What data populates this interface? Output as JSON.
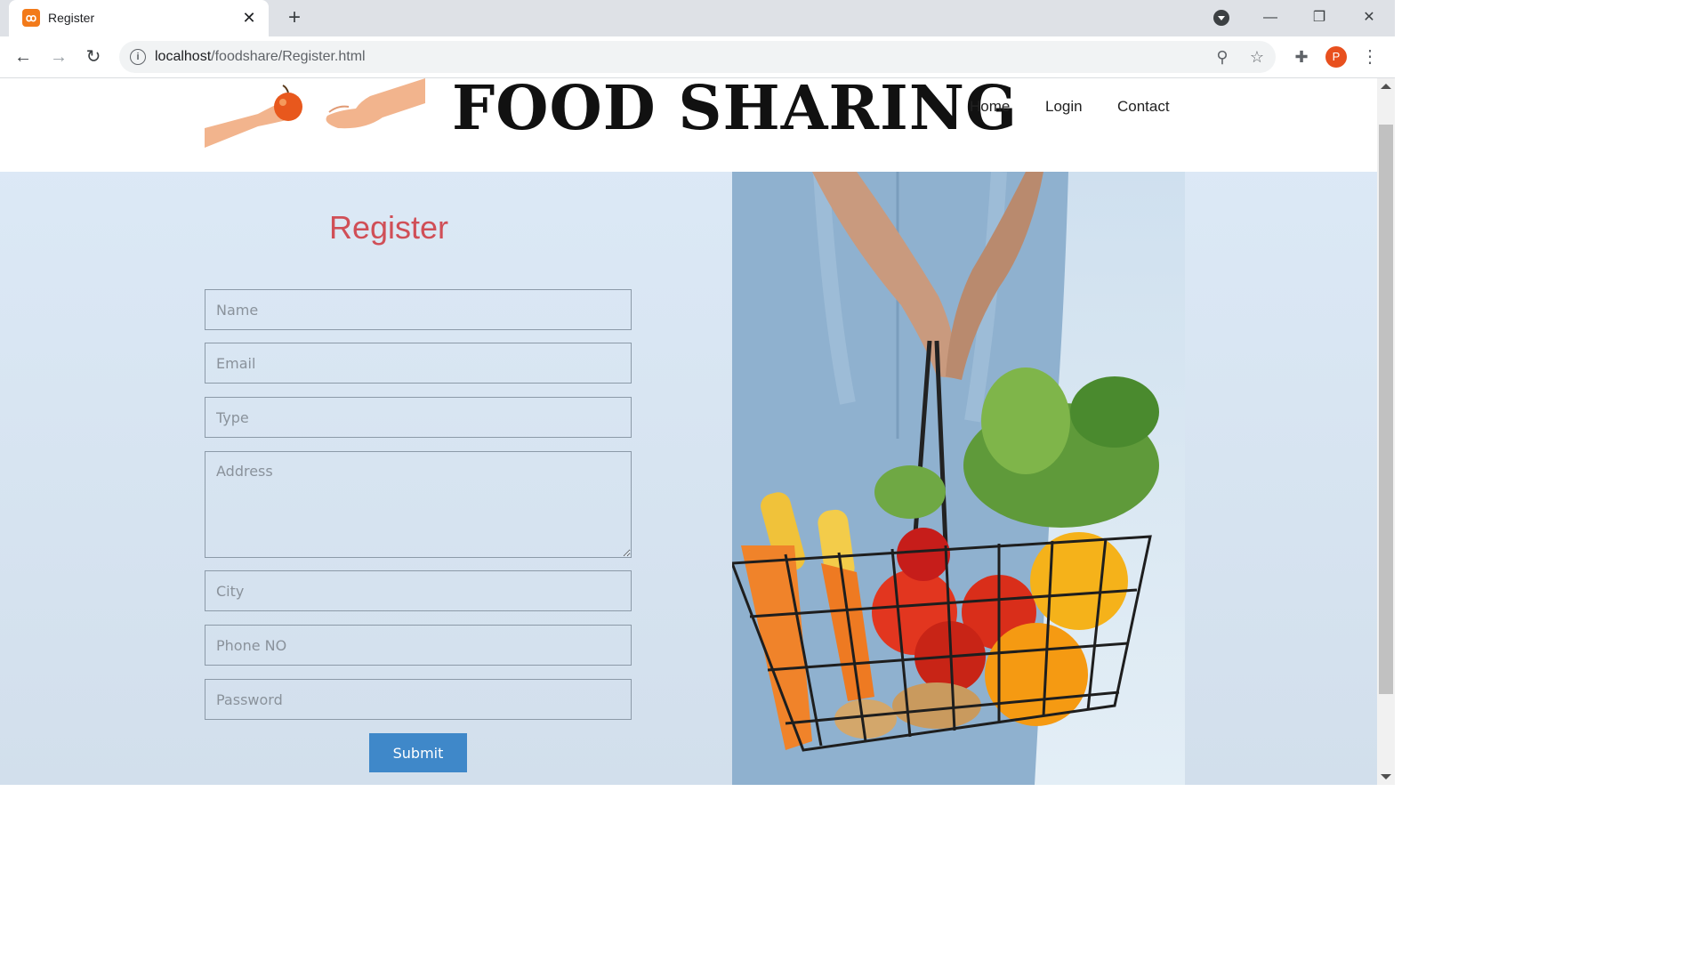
{
  "browser": {
    "tab_title": "Register",
    "url_host": "localhost",
    "url_path": "/foodshare/Register.html",
    "profile_initial": "P",
    "icons": [
      "back-icon",
      "forward-icon",
      "reload-icon",
      "info-icon",
      "zoom-icon",
      "star-icon",
      "extensions-icon",
      "menu-icon"
    ]
  },
  "site": {
    "title": "FOOD SHARING",
    "nav": [
      "Home",
      "Login",
      "Contact"
    ]
  },
  "form": {
    "title": "Register",
    "placeholders": {
      "name": "Name",
      "email": "Email",
      "type": "Type",
      "address": "Address",
      "city": "City",
      "phone": "Phone NO",
      "password": "Password"
    },
    "submit_label": "Submit"
  },
  "colors": {
    "form_title": "#d04f57",
    "submit_bg": "#3f88c9",
    "page_bg": "#ddeaf7"
  }
}
